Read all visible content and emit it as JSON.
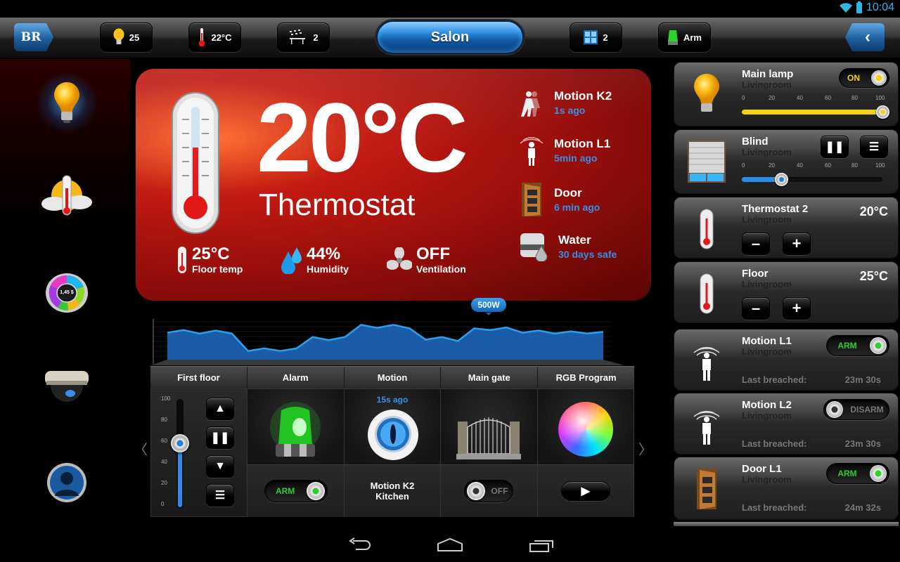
{
  "status_bar": {
    "time": "10:04",
    "wifi_icon": "wifi-icon",
    "battery_icon": "battery-icon"
  },
  "toolbar": {
    "home_logo": "BR",
    "lights_count": "25",
    "temperature": "22°C",
    "scenes_count": "2",
    "room_name": "Salon",
    "windows_count": "2",
    "alarm_label": "Arm",
    "back_icon": "chevron-left-icon"
  },
  "sidebar": {
    "items": [
      {
        "name": "lighting",
        "icon": "light-bulb-icon",
        "active": true
      },
      {
        "name": "climate",
        "icon": "weather-thermometer-icon"
      },
      {
        "name": "energy",
        "icon": "energy-cost-gauge-icon",
        "center_text": "1,45 $"
      },
      {
        "name": "cameras",
        "icon": "security-camera-icon"
      },
      {
        "name": "users",
        "icon": "user-profile-icon"
      }
    ]
  },
  "hero": {
    "temperature": "20°C",
    "title": "Thermostat",
    "stats": [
      {
        "value": "25°C",
        "label": "Floor temp",
        "icon": "thermometer-icon"
      },
      {
        "value": "44%",
        "label": "Humidity",
        "icon": "water-drops-icon"
      },
      {
        "value": "OFF",
        "label": "Ventilation",
        "icon": "fan-icon"
      }
    ],
    "sensors": [
      {
        "name": "Motion K2",
        "time": "1s ago",
        "icon": "motion-walking-icon"
      },
      {
        "name": "Motion L1",
        "time": "5min ago",
        "icon": "motion-person-icon"
      },
      {
        "name": "Door",
        "time": "6 min ago",
        "icon": "door-icon"
      },
      {
        "name": "Water",
        "time": "30 days safe",
        "icon": "water-sensor-icon"
      }
    ]
  },
  "chart_data": {
    "type": "area",
    "title": "",
    "xlabel": "",
    "ylabel": "",
    "tooltip": {
      "label": "500W",
      "index": 18
    },
    "values": [
      62,
      68,
      60,
      67,
      60,
      20,
      26,
      20,
      26,
      52,
      45,
      52,
      80,
      73,
      80,
      72,
      46,
      52,
      43,
      72,
      68,
      74,
      62,
      67,
      60,
      65,
      60,
      64
    ],
    "ylim": [
      0,
      100
    ],
    "grid": true,
    "color": "#2aa0f0"
  },
  "controls": {
    "headers": [
      "First floor",
      "Alarm",
      "Motion",
      "Main gate",
      "RGB Program"
    ],
    "first_floor": {
      "scale": [
        "100",
        "80",
        "60",
        "40",
        "20",
        "0"
      ],
      "level": 60,
      "buttons": [
        "up-icon",
        "pause-icon",
        "down-icon",
        "menu-icon"
      ]
    },
    "alarm": {
      "toggle_label": "ARM",
      "state": "on"
    },
    "motion": {
      "time": "15s ago",
      "name": "Motion K2",
      "location": "Kitchen"
    },
    "main_gate": {
      "toggle_label": "OFF",
      "state": "off"
    },
    "rgb_program": {
      "play_icon": "play-icon"
    },
    "prev_icon": "〈",
    "next_icon": "〉"
  },
  "devices": [
    {
      "title": "Main lamp",
      "room": "Livingroom",
      "type": "lamp",
      "toggle_label": "ON",
      "level": 100
    },
    {
      "title": "Blind",
      "room": "Livingroom",
      "type": "blind",
      "level": 28
    },
    {
      "title": "Thermostat 2",
      "room": "Livingroom",
      "type": "thermostat",
      "value": "20°C"
    },
    {
      "title": "Floor",
      "room": "Livingroom",
      "type": "thermostat",
      "value": "25°C"
    },
    {
      "title": "Motion L1",
      "room": "Livingroom",
      "type": "motion",
      "toggle_label": "ARM",
      "state": "on",
      "breach_label": "Last breached:",
      "breach_value": "23m 30s"
    },
    {
      "title": "Motion L2",
      "room": "Livingroom",
      "type": "motion",
      "toggle_label": "DISARM",
      "state": "off",
      "breach_label": "Last breached:",
      "breach_value": "23m 30s"
    },
    {
      "title": "Door L1",
      "room": "Livingroom",
      "type": "door",
      "toggle_label": "ARM",
      "state": "on",
      "breach_label": "Last breached:",
      "breach_value": "24m 32s"
    }
  ],
  "slider_scale": [
    "0",
    "20",
    "40",
    "60",
    "80",
    "100"
  ],
  "navbar": {
    "back": "back-icon",
    "home": "home-icon",
    "recents": "recent-apps-icon"
  }
}
